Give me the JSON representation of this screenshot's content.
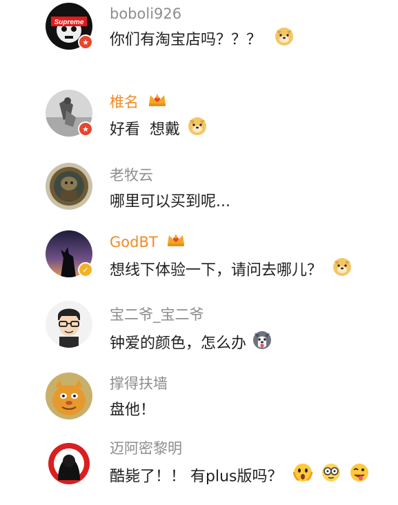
{
  "comments": [
    {
      "username": "boboli926",
      "text": "你们有淘宝店吗？？？",
      "avatar_label": "Supreme",
      "emoji": [
        "doge-emoji"
      ]
    },
    {
      "username": "椎名",
      "text": "好看  想戴",
      "emoji": [
        "doge-emoji"
      ]
    },
    {
      "username": "老牧云",
      "text": "哪里可以买到呢..."
    },
    {
      "username": "GodBT",
      "text": "想线下体验一下，请问去哪儿？",
      "emoji": [
        "doge-emoji"
      ]
    },
    {
      "username": "宝二爷_宝二爷",
      "text": "钟爱的颜色，怎么办",
      "emoji": [
        "husky-emoji"
      ]
    },
    {
      "username": "撑得扶墙",
      "text": "盘他！"
    },
    {
      "username": "迈阿密黎明",
      "text": "酷毙了！！ 有plus版吗？",
      "emoji": [
        "shocked-emoji",
        "glasses-emoji",
        "tongue-emoji"
      ]
    }
  ],
  "colors": {
    "vip_name": "#f08a24",
    "normal_name": "#8d8d8d",
    "text": "#1f1f1f",
    "badge_red": "#e8452c",
    "badge_gold": "#f2b227"
  }
}
